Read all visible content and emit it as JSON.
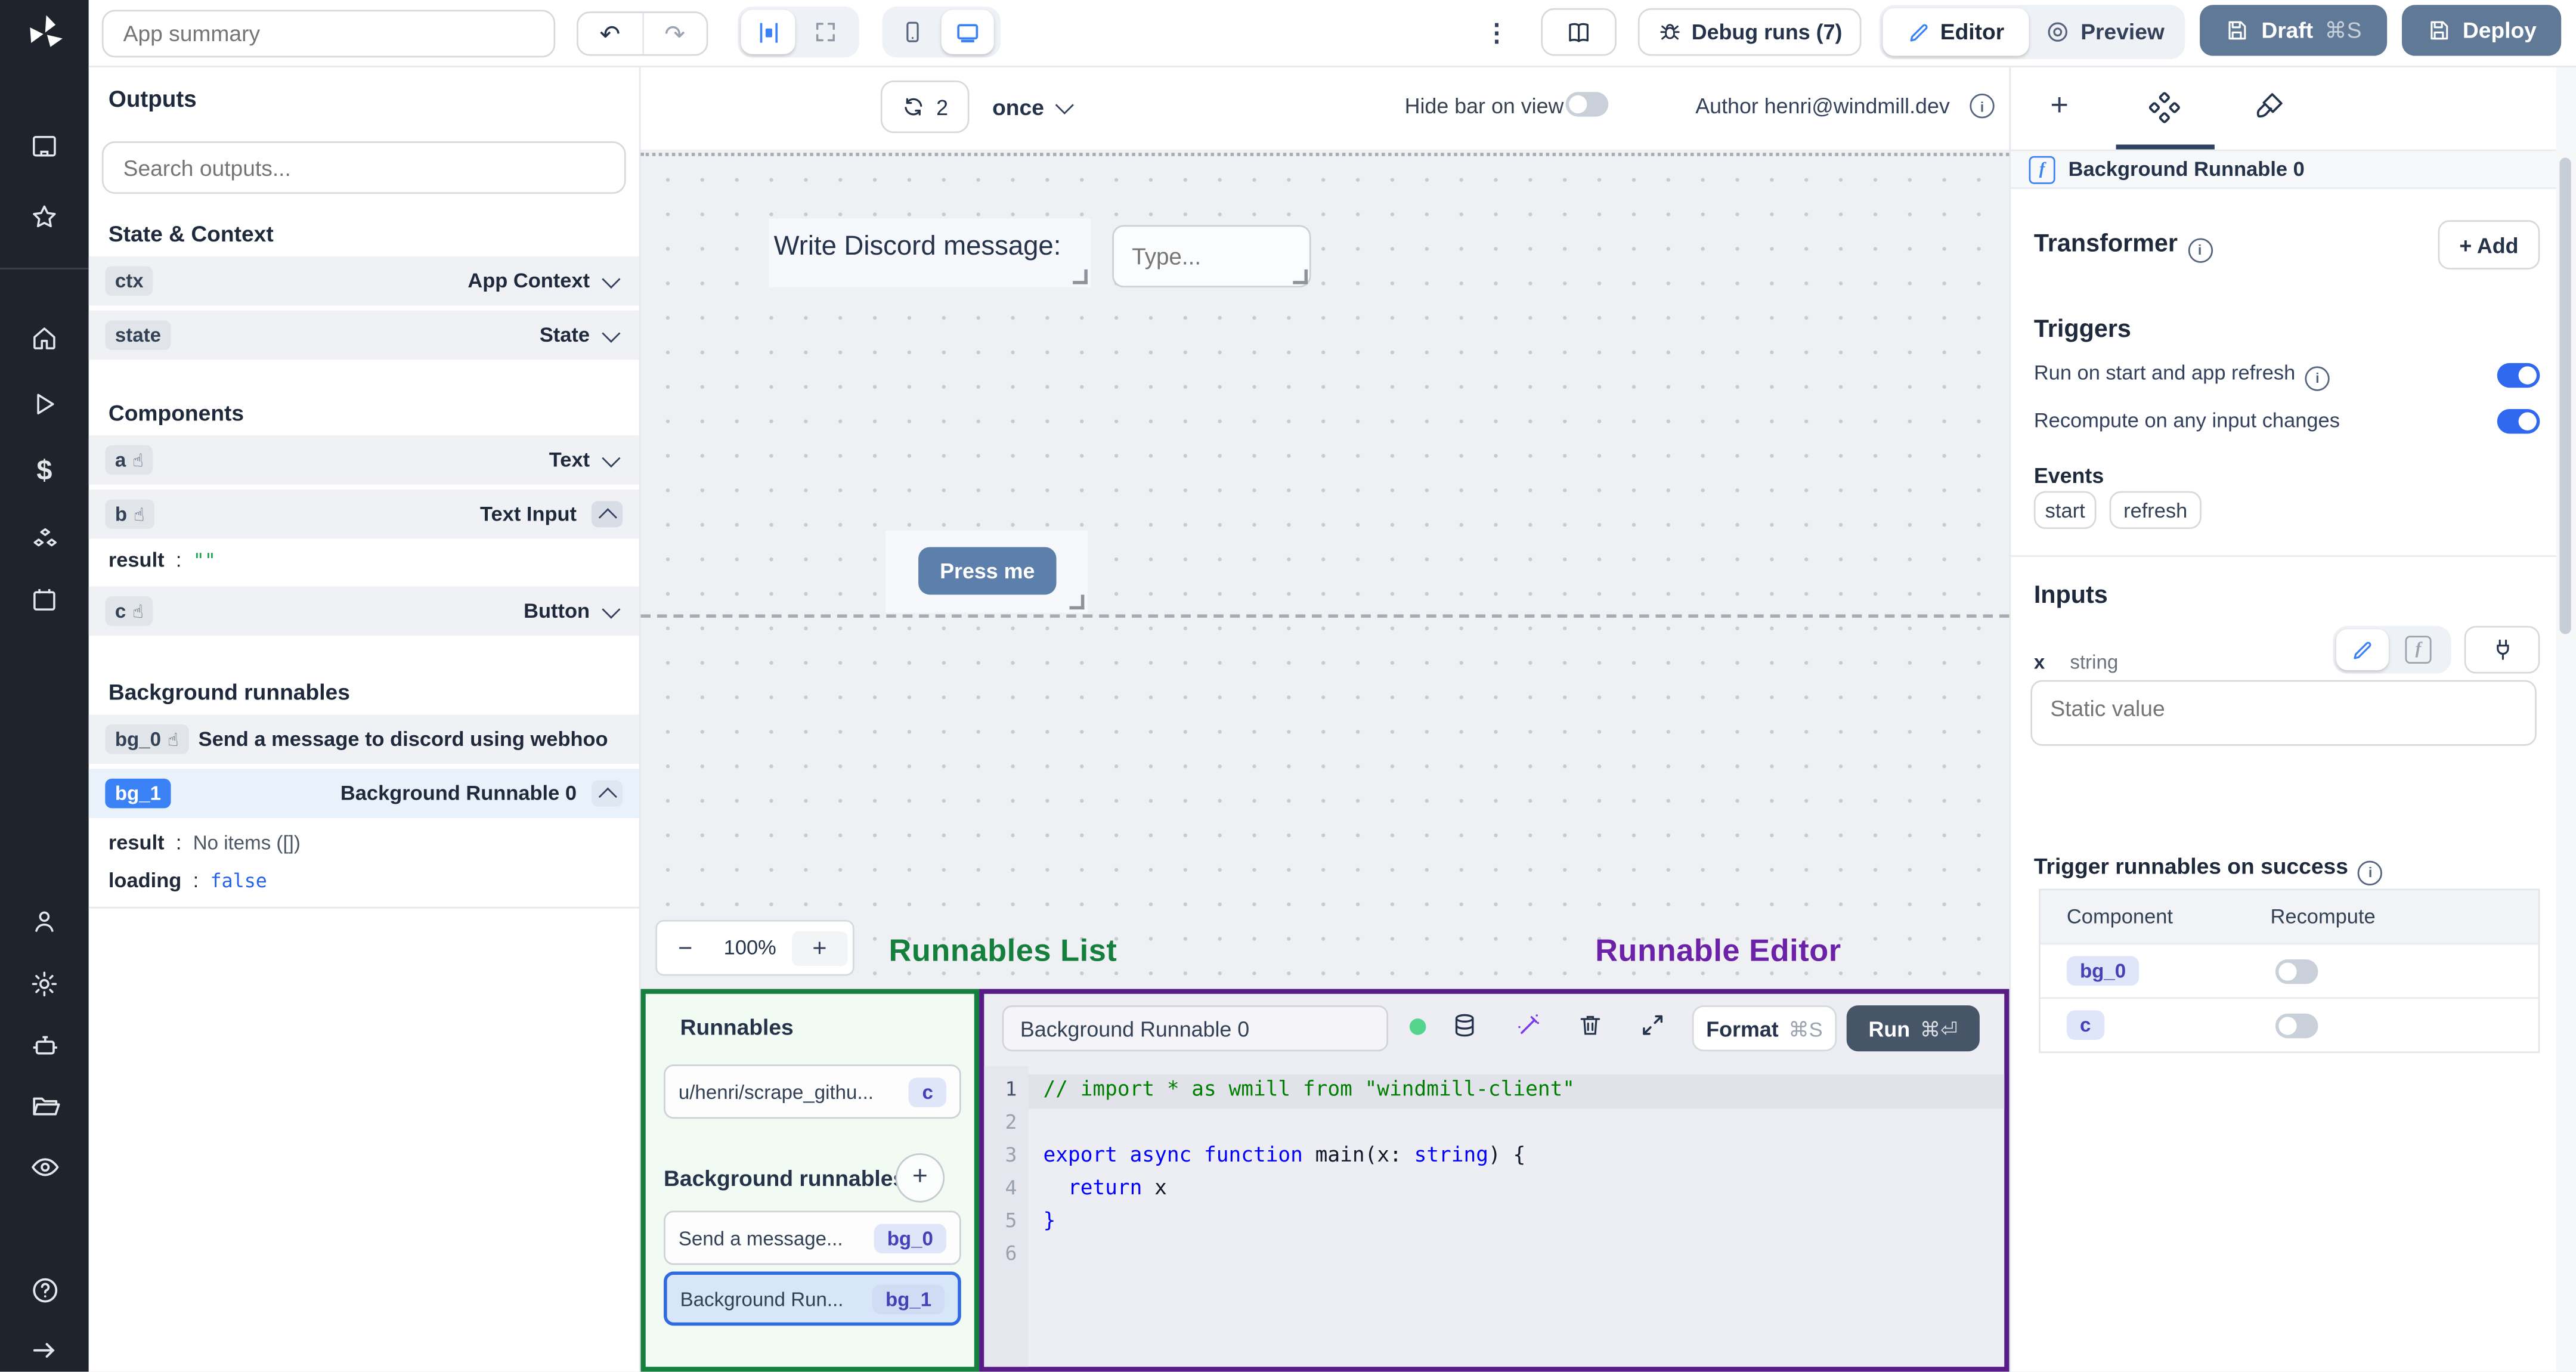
{
  "topbar": {
    "app_summary": "App summary",
    "debug_runs": "Debug runs (7)",
    "editor": "Editor",
    "preview": "Preview",
    "draft": "Draft",
    "draft_shortcut": "⌘S",
    "deploy": "Deploy"
  },
  "outputs": {
    "title": "Outputs",
    "search_placeholder": "Search outputs...",
    "state_context_title": "State & Context",
    "ctx_badge": "ctx",
    "ctx_label": "App Context",
    "state_badge": "state",
    "state_label": "State",
    "components_title": "Components",
    "a_badge": "a",
    "a_label": "Text",
    "b_badge": "b",
    "b_label": "Text Input",
    "b_result_key": "result",
    "b_result_value": "\"\"",
    "c_badge": "c",
    "c_label": "Button",
    "background_title": "Background runnables",
    "bg0_badge": "bg_0",
    "bg0_label": "Send a message to discord using webhoo",
    "bg1_badge": "bg_1",
    "bg1_label": "Background Runnable 0",
    "bg1_result_key": "result",
    "bg1_result_value": "No items ([])",
    "bg1_loading_key": "loading",
    "bg1_loading_value": "false"
  },
  "canvas": {
    "refresh_count": "2",
    "frequency": "once",
    "hide_bar": "Hide bar on view",
    "author": "Author henri@windmill.dev",
    "text_component": "Write Discord message:",
    "input_placeholder": "Type...",
    "button_label": "Press me",
    "zoom_out": "−",
    "zoom_level": "100%",
    "zoom_in": "+"
  },
  "annotations": {
    "list_label": "Runnables List",
    "editor_label": "Runnable Editor",
    "green": "#15803d",
    "purple": "#6b21a8"
  },
  "runnables": {
    "title": "Runnables",
    "item1": "u/henri/scrape_githu...",
    "item1_badge": "c",
    "bg_title": "Background runnables",
    "item2": "Send a message...",
    "item2_badge": "bg_0",
    "item3": "Background Run...",
    "item3_badge": "bg_1"
  },
  "editor": {
    "name": "Background Runnable 0",
    "format": "Format",
    "format_shortcut": "⌘S",
    "run": "Run",
    "run_shortcut": "⌘⏎",
    "lines": [
      "1",
      "2",
      "3",
      "4",
      "5",
      "6"
    ],
    "code": {
      "comment": "// import * as wmill from \"windmill-client\"",
      "kw1": "export async function ",
      "fn": "main",
      "p1": "(x: ",
      "type": "string",
      "p2": ") {",
      "kw2": "  return",
      "var": " x",
      "close": "}"
    }
  },
  "panel": {
    "title": "Background Runnable 0",
    "transformer": "Transformer",
    "add": "+ Add",
    "triggers": "Triggers",
    "run_on_start": "Run on start and app refresh",
    "recompute": "Recompute on any input changes",
    "events": "Events",
    "ev_start": "start",
    "ev_refresh": "refresh",
    "inputs": "Inputs",
    "input_name": "x",
    "input_type": "string",
    "static_placeholder": "Static value",
    "trigger_success": "Trigger runnables on success",
    "col_component": "Component",
    "col_recompute": "Recompute",
    "row1_badge": "bg_0",
    "row2_badge": "c"
  },
  "colors": {
    "accent_blue": "#3b82f6",
    "toggle_on": "#3069f0",
    "slate_button": "#5f7997",
    "run_button": "#475569",
    "press_button": "#5c80ab"
  }
}
